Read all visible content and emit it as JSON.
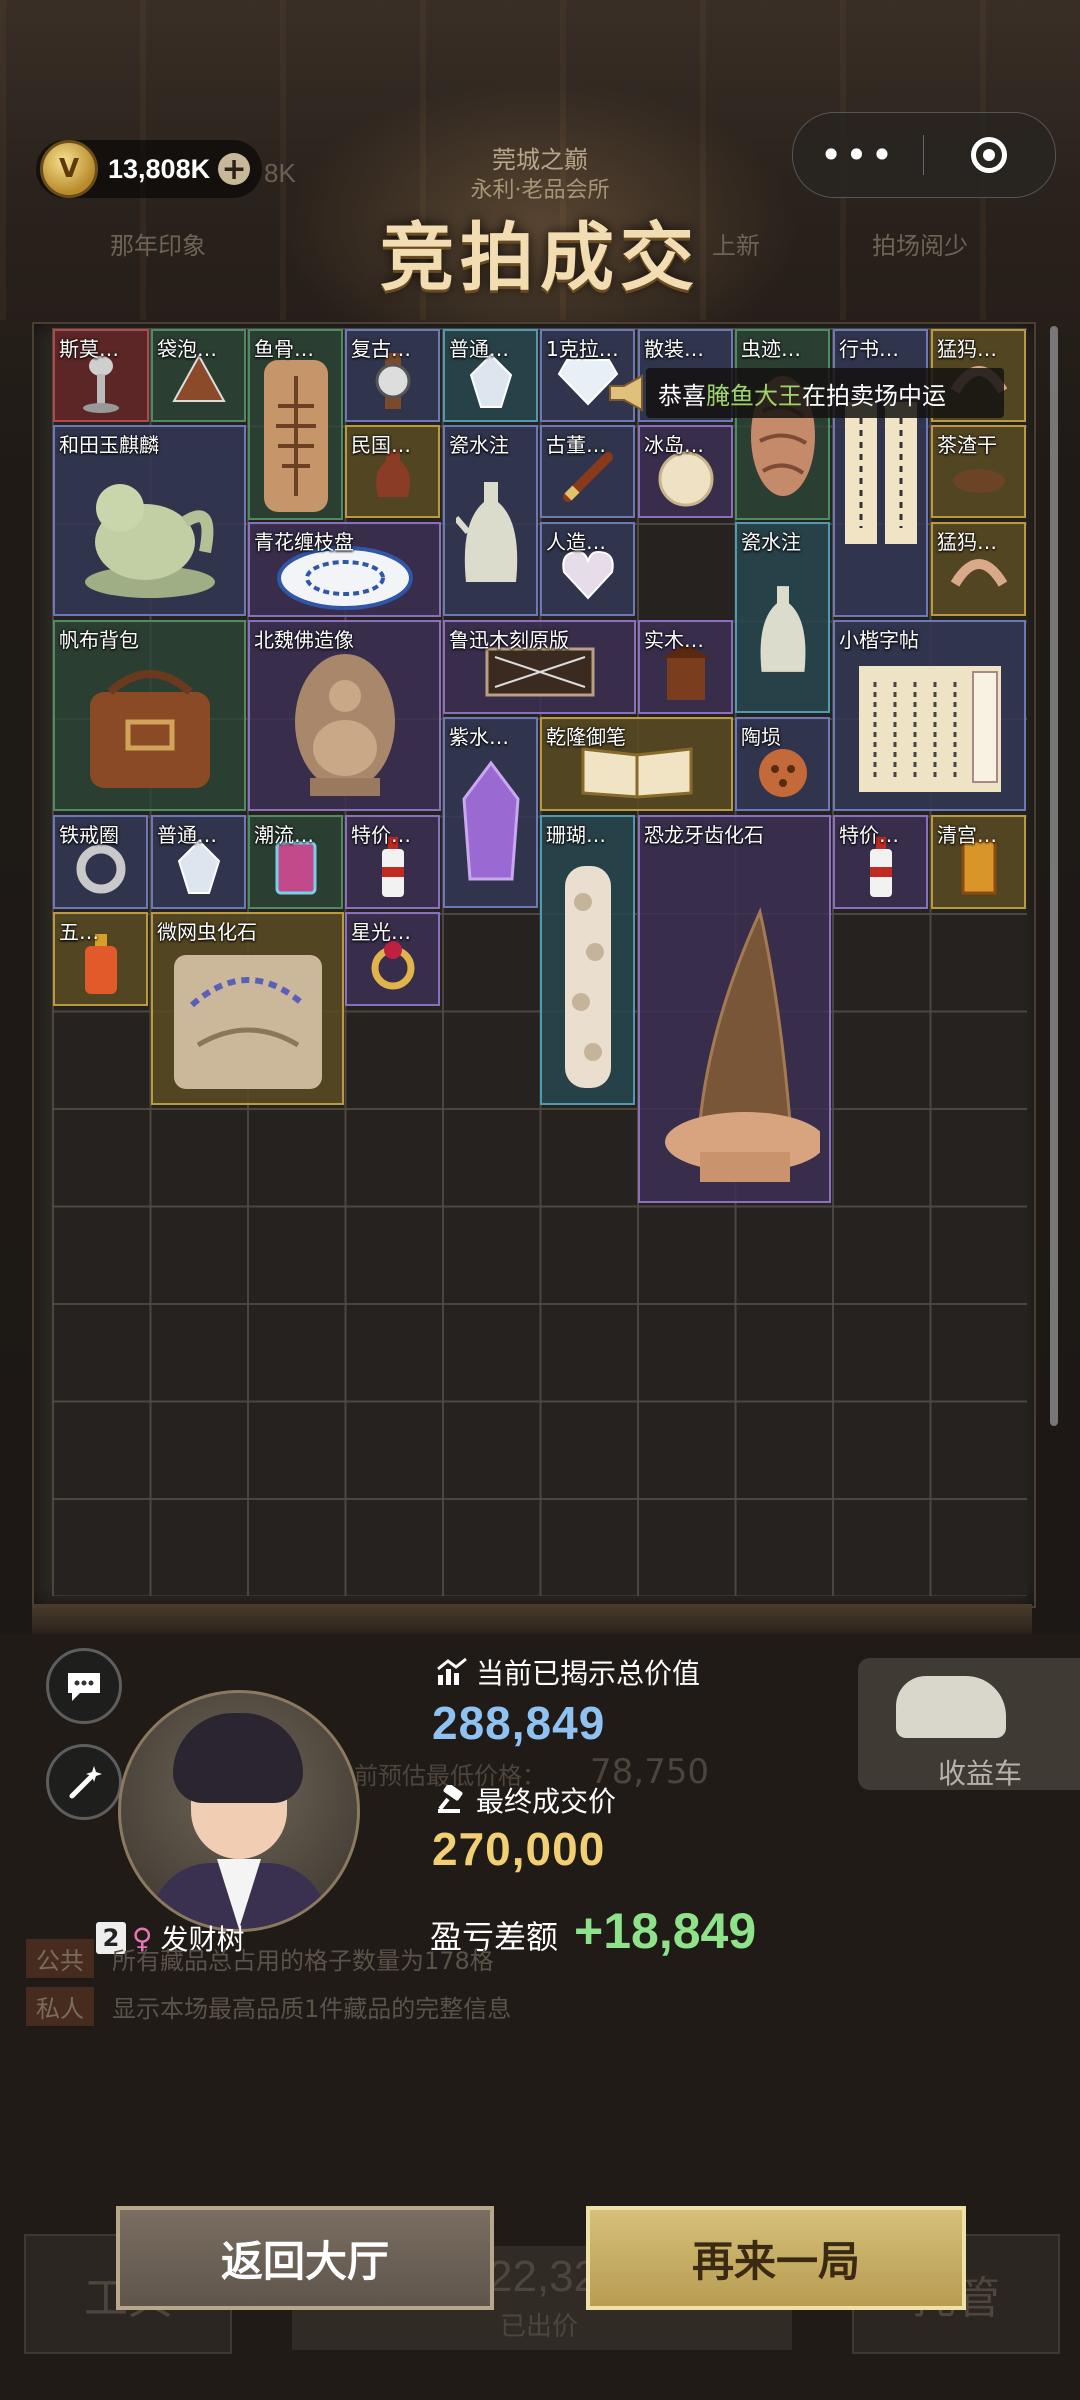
{
  "header": {
    "coins": "13,808K",
    "coins_ghost": "8K",
    "venue_line1": "莞城之巅",
    "venue_line2": "永利·老品会所",
    "title": "竞拍成交",
    "ghost_left": "那年印象",
    "ghost_mid": "上新",
    "ghost_right": "拍场阅少"
  },
  "capsule": {
    "more": "•••"
  },
  "notice": {
    "prefix": "恭喜",
    "name": "腌鱼大王",
    "suffix": "在拍卖场中运"
  },
  "items": [
    {
      "label": "斯莫…"
    },
    {
      "label": "袋泡…"
    },
    {
      "label": "鱼骨…"
    },
    {
      "label": "复古…"
    },
    {
      "label": "普通…"
    },
    {
      "label": "1克拉…"
    },
    {
      "label": "散装…"
    },
    {
      "label": "虫迹…"
    },
    {
      "label": "行书…"
    },
    {
      "label": "猛犸…"
    },
    {
      "label": "和田玉麒麟"
    },
    {
      "label": "民国…"
    },
    {
      "label": "瓷水注"
    },
    {
      "label": "古董…"
    },
    {
      "label": "冰岛…"
    },
    {
      "label": "茶渣干"
    },
    {
      "label": "青花缠枝盘"
    },
    {
      "label": "人造…"
    },
    {
      "label": "瓷水注"
    },
    {
      "label": "猛犸…"
    },
    {
      "label": "帆布背包"
    },
    {
      "label": "北魏佛造像"
    },
    {
      "label": "鲁迅木刻原版"
    },
    {
      "label": "实木…"
    },
    {
      "label": "小楷字帖"
    },
    {
      "label": "紫水…"
    },
    {
      "label": "乾隆御笔"
    },
    {
      "label": "陶埙"
    },
    {
      "label": "铁戒圈"
    },
    {
      "label": "普通…"
    },
    {
      "label": "潮流…"
    },
    {
      "label": "特价…"
    },
    {
      "label": "珊瑚…"
    },
    {
      "label": "恐龙牙齿化石"
    },
    {
      "label": "特价…"
    },
    {
      "label": "清宫…"
    },
    {
      "label": "五…"
    },
    {
      "label": "微网虫化石"
    },
    {
      "label": "星光…"
    }
  ],
  "stats": {
    "revealed_label": "当前已揭示总价值",
    "revealed_value": "288,849",
    "final_label": "最终成交价",
    "final_value": "270,000",
    "diff_label": "盈亏差额",
    "diff_value": "+18,849"
  },
  "player": {
    "rank": "2",
    "gender": "♀",
    "name": "发财树"
  },
  "car_label": "收益车",
  "ghost": {
    "estimate_label": "当前预估最低价格：",
    "estimate_value": "78,750",
    "chat1_tag": "公共",
    "chat1_text": "所有藏品总占用的格子数量为178格",
    "chat2_tag": "私人",
    "chat2_text": "显示本场最高品质1件藏品的完整信息",
    "left_btn": "工具",
    "right_btn": "托管",
    "bid_num": "22,32",
    "bid_sub": "已出价"
  },
  "buttons": {
    "back": "返回大厅",
    "again": "再来一局"
  },
  "colors": {
    "revealed": "#8fc2f2",
    "final": "#f2cf73",
    "diff": "#8de28a",
    "gold_button": "#d6c07a"
  }
}
